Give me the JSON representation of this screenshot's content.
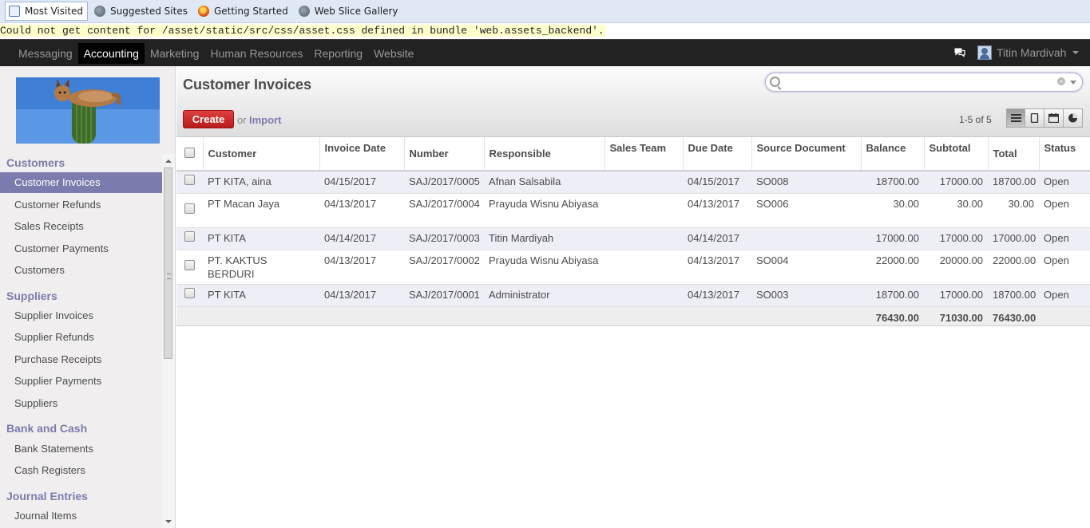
{
  "favorites": [
    {
      "label": "Most Visited",
      "icon": "most-visited-icon"
    },
    {
      "label": "Suggested Sites",
      "icon": "globe-icon"
    },
    {
      "label": "Getting Started",
      "icon": "firefox-icon"
    },
    {
      "label": "Web Slice Gallery",
      "icon": "globe-icon"
    }
  ],
  "error_message": "Could not get content for /asset/static/src/css/asset.css defined in bundle 'web.assets_backend'.",
  "topnav": {
    "items": [
      "Messaging",
      "Accounting",
      "Marketing",
      "Human Resources",
      "Reporting",
      "Website"
    ],
    "active": "Accounting",
    "user": "Titin Mardivah"
  },
  "sidebar": {
    "customers_header": "Customers",
    "customers_items": [
      "Customer Invoices",
      "Customer Refunds",
      "Sales Receipts",
      "Customer Payments",
      "Customers"
    ],
    "suppliers_header": "Suppliers",
    "suppliers_items": [
      "Supplier Invoices",
      "Supplier Refunds",
      "Purchase Receipts",
      "Supplier Payments",
      "Suppliers"
    ],
    "bank_header": "Bank and Cash",
    "bank_items": [
      "Bank Statements",
      "Cash Registers"
    ],
    "journal_header": "Journal Entries",
    "journal_items": [
      "Journal Items"
    ],
    "selected": "Customer Invoices"
  },
  "main": {
    "title": "Customer Invoices",
    "search_value": "",
    "create_label": "Create",
    "or_label": "or",
    "import_label": "Import",
    "pager": "1-5 of 5",
    "views": [
      "list-view-icon",
      "form-view-icon",
      "calendar-view-icon",
      "graph-view-icon"
    ]
  },
  "table": {
    "columns": [
      "Customer",
      "Invoice Date",
      "Number",
      "Responsible",
      "Sales Team",
      "Due Date",
      "Source Document",
      "Balance",
      "Subtotal",
      "Total",
      "Status"
    ],
    "rows": [
      {
        "customer": "PT KITA, aina",
        "invoice_date": "04/15/2017",
        "number": "SAJ/2017/0005",
        "responsible": "Afnan Salsabila",
        "sales_team": "",
        "due_date": "04/15/2017",
        "source": "SO008",
        "balance": "18700.00",
        "subtotal": "17000.00",
        "total": "18700.00",
        "status": "Open"
      },
      {
        "customer": "PT Macan Jaya",
        "invoice_date": "04/13/2017",
        "number": "SAJ/2017/0004",
        "responsible": "Prayuda Wisnu Abiyasa",
        "sales_team": "",
        "due_date": "04/13/2017",
        "source": "SO006",
        "balance": "30.00",
        "subtotal": "30.00",
        "total": "30.00",
        "status": "Open"
      },
      {
        "customer": "PT KITA",
        "invoice_date": "04/14/2017",
        "number": "SAJ/2017/0003",
        "responsible": "Titin Mardiyah",
        "sales_team": "",
        "due_date": "04/14/2017",
        "source": "",
        "balance": "17000.00",
        "subtotal": "17000.00",
        "total": "17000.00",
        "status": "Open"
      },
      {
        "customer": "PT. KAKTUS BERDURI",
        "invoice_date": "04/13/2017",
        "number": "SAJ/2017/0002",
        "responsible": "Prayuda Wisnu Abiyasa",
        "sales_team": "",
        "due_date": "04/13/2017",
        "source": "SO004",
        "balance": "22000.00",
        "subtotal": "20000.00",
        "total": "22000.00",
        "status": "Open"
      },
      {
        "customer": "PT KITA",
        "invoice_date": "04/13/2017",
        "number": "SAJ/2017/0001",
        "responsible": "Administrator",
        "sales_team": "",
        "due_date": "04/13/2017",
        "source": "SO003",
        "balance": "18700.00",
        "subtotal": "17000.00",
        "total": "18700.00",
        "status": "Open"
      }
    ],
    "totals": {
      "balance": "76430.00",
      "subtotal": "71030.00",
      "total": "76430.00"
    }
  },
  "colors": {
    "accent": "#7c7bad",
    "create_button": "#c62828",
    "topbar": "#222222"
  }
}
